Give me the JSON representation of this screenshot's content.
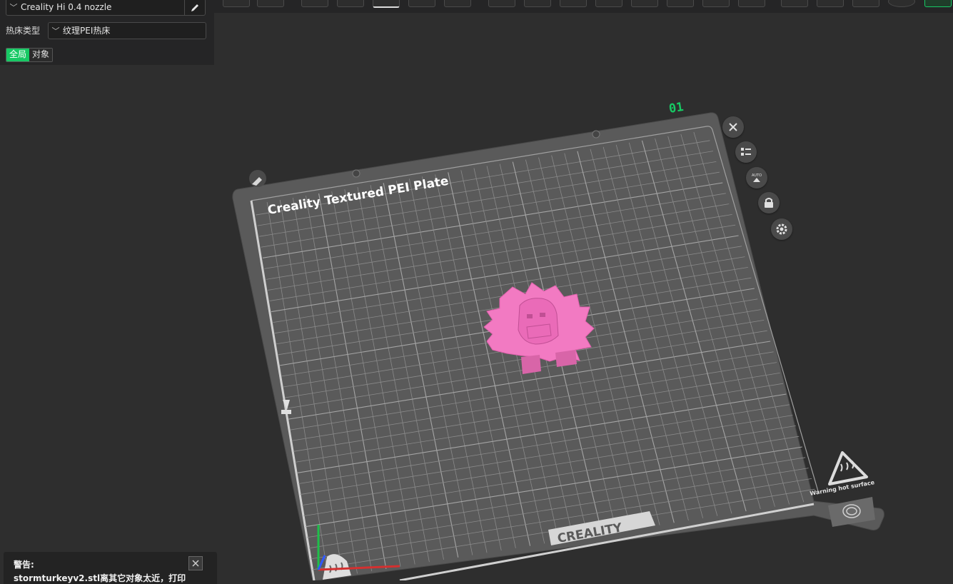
{
  "sidebar": {
    "printer": "Creality Hi 0.4 nozzle",
    "bed_type_label": "热床类型",
    "bed_type_value": "纹理PEI热床",
    "scope_tabs": [
      "全局",
      "对象"
    ]
  },
  "plate": {
    "number": "01",
    "name": "Creality Textured PEI Plate",
    "brand": "CREALITY",
    "warning": "Warning hot surface"
  },
  "notification": {
    "title": "警告:",
    "message": "stormturkeyv2.stl离其它对象太近，打印"
  },
  "colors": {
    "accent": "#17c964",
    "model": "#f27ac2",
    "plate": "#5b5b5b",
    "grid": "#888888"
  },
  "icons": [
    "pencil-icon",
    "close-icon",
    "objects-list-icon",
    "auto-orient-icon",
    "lock-icon",
    "gear-icon",
    "hot-surface-icon",
    "fingerprint-icon"
  ]
}
